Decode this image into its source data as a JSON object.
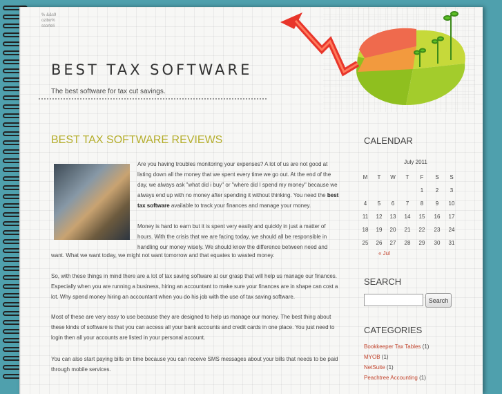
{
  "site": {
    "title": "BEST TAX SOFTWARE",
    "tagline": "The best software for tax cut savings.",
    "scribble": [
      "% &&s9",
      "ozibo%",
      "ssorteli"
    ]
  },
  "post": {
    "title": "BEST TAX SOFTWARE REVIEWS",
    "p1_start": "Are you having troubles monitoring your expenses? A lot of us are not good at listing down all the money that we spent every time we go out. At the end of the day, we always ask \"what did i buy\" or \"where did I spend my money\" because we always end up with no money after spending it without thinking. You need the ",
    "p1_bold": "best tax software",
    "p1_end": " available to track your finances and manage your money.",
    "p2_a": "Money is hard to earn but it is spent very easily and quickly in just a matter of hours. With the crisis that we are facing today, we should all be responsible in handling our money wisely. We should know the difference between need and",
    "p2_b": "want. What we want today, we might not want tomorrow and that equates to wasted money.",
    "p3": "So, with these things in mind there are a lot of tax saving software at our grasp that will help us manage our finances. Especially when you are running a business, hiring an accountant to make sure your finances are in shape can cost a lot. Why spend money hiring an accountant when you do his job with the use of tax saving software.",
    "p4": "Most of these are very easy to use because they are designed to help us manage our money. The best thing about these kinds of software is that you can access all your bank accounts and credit cards in one place. You just need to login then all your accounts are listed in your personal account.",
    "p5": "You can also start paying bills on time because you can receive SMS messages about your bills that needs to be paid through mobile services."
  },
  "calendar": {
    "title": "CALENDAR",
    "caption": "July 2011",
    "days": [
      "M",
      "T",
      "W",
      "T",
      "F",
      "S",
      "S"
    ],
    "weeks": [
      [
        "",
        "",
        "",
        "",
        "1",
        "2",
        "3"
      ],
      [
        "4",
        "5",
        "6",
        "7",
        "8",
        "9",
        "10"
      ],
      [
        "11",
        "12",
        "13",
        "14",
        "15",
        "16",
        "17"
      ],
      [
        "18",
        "19",
        "20",
        "21",
        "22",
        "23",
        "24"
      ],
      [
        "25",
        "26",
        "27",
        "28",
        "29",
        "30",
        "31"
      ]
    ],
    "prev": "« Jul"
  },
  "search": {
    "title": "SEARCH",
    "placeholder": "",
    "button": "Search"
  },
  "categories": {
    "title": "CATEGORIES",
    "items": [
      {
        "label": "Bookkeeper Tax Tables",
        "count": "(1)"
      },
      {
        "label": "MYOB",
        "count": "(1)"
      },
      {
        "label": "NetSuite",
        "count": "(1)"
      },
      {
        "label": "Peachtree Accounting",
        "count": "(1)"
      }
    ]
  },
  "colors": {
    "background": "#4fa0ad",
    "post_title": "#b5ae2c",
    "link": "#c2452e",
    "arrow": "#e8352a"
  },
  "icons": {
    "header_graphic": "pie-chart-with-rising-arrow-icon",
    "post_image": "money-stack-photo"
  }
}
